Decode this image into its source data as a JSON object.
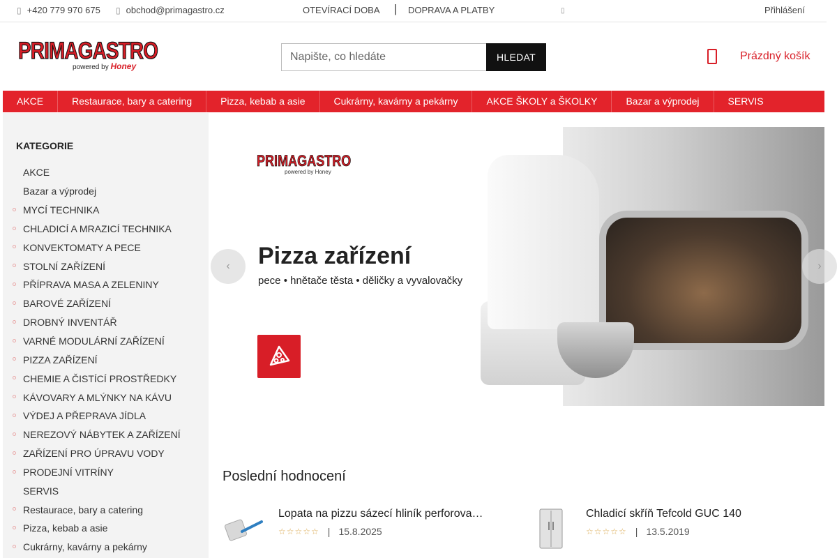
{
  "topbar": {
    "phone": "+420 779 970 675",
    "email": "obchod@primagastro.cz",
    "opening_hours": "OTEVÍRACÍ DOBA",
    "separator": "|",
    "shipping": "DOPRAVA A PLATBY",
    "login": "Přihlášení",
    "phone_icon": "phone-icon",
    "email_icon": "mail-icon"
  },
  "header": {
    "logo_text": "PRIMAGASTRO",
    "logo_tag": "powered by",
    "logo_brand": "Honey",
    "search_placeholder": "Napište, co hledáte",
    "search_button": "HLEDAT",
    "cart_label": "Prázdný košík",
    "accent_color": "#e3232b"
  },
  "menu": [
    "AKCE",
    "Restaurace, bary a catering",
    "Pizza, kebab a asie",
    "Cukrárny, kavárny a pekárny",
    "AKCE ŠKOLY a ŠKOLKY",
    "Bazar a výprodej",
    "SERVIS"
  ],
  "sidebar": {
    "title": "KATEGORIE",
    "items": [
      {
        "label": "AKCE",
        "bullet": false
      },
      {
        "label": "Bazar a výprodej",
        "bullet": false
      },
      {
        "label": "MYCÍ TECHNIKA",
        "bullet": true
      },
      {
        "label": "CHLADICÍ A MRAZICÍ TECHNIKA",
        "bullet": true
      },
      {
        "label": "KONVEKTOMATY A PECE",
        "bullet": true
      },
      {
        "label": "STOLNÍ ZAŘÍZENÍ",
        "bullet": true
      },
      {
        "label": "PŘÍPRAVA MASA A ZELENINY",
        "bullet": true
      },
      {
        "label": "BAROVÉ ZAŘÍZENÍ",
        "bullet": true
      },
      {
        "label": "DROBNÝ INVENTÁŘ",
        "bullet": true
      },
      {
        "label": "VARNÉ MODULÁRNÍ ZAŘÍZENÍ",
        "bullet": true
      },
      {
        "label": "PIZZA ZAŘÍZENÍ",
        "bullet": true
      },
      {
        "label": "CHEMIE A ČISTÍCÍ PROSTŘEDKY",
        "bullet": true
      },
      {
        "label": "KÁVOVARY A MLÝNKY NA KÁVU",
        "bullet": true
      },
      {
        "label": "VÝDEJ A PŘEPRAVA JÍDLA",
        "bullet": true
      },
      {
        "label": "NEREZOVÝ NÁBYTEK A ZAŘÍZENÍ",
        "bullet": true
      },
      {
        "label": "ZAŘÍZENÍ PRO ÚPRAVU VODY",
        "bullet": true
      },
      {
        "label": "PRODEJNÍ VITRÍNY",
        "bullet": true
      },
      {
        "label": "SERVIS",
        "bullet": false
      },
      {
        "label": "Restaurace, bary a catering",
        "bullet": true
      },
      {
        "label": "Pizza, kebab a asie",
        "bullet": true
      },
      {
        "label": "Cukrárny, kavárny a pekárny",
        "bullet": true
      }
    ]
  },
  "banner": {
    "logo_text": "PRIMAGASTRO",
    "logo_tag": "powered by Honey",
    "headline": "Pizza zařízení",
    "subline": "pece • hnětače těsta • děličky a vyvalovačky",
    "prev_icon": "chevron-left-icon",
    "next_icon": "chevron-right-icon"
  },
  "reviews": {
    "title": "Poslední hodnocení",
    "items": [
      {
        "name": "Lopata na pizzu sázecí hliník perforova…",
        "stars": "☆☆☆☆☆",
        "separator": "|",
        "date": "15.8.2025",
        "thumb": "pizza-peel-image"
      },
      {
        "name": "Chladicí skříň Tefcold GUC 140",
        "stars": "☆☆☆☆☆",
        "separator": "|",
        "date": "13.5.2019",
        "thumb": "fridge-image"
      }
    ]
  }
}
